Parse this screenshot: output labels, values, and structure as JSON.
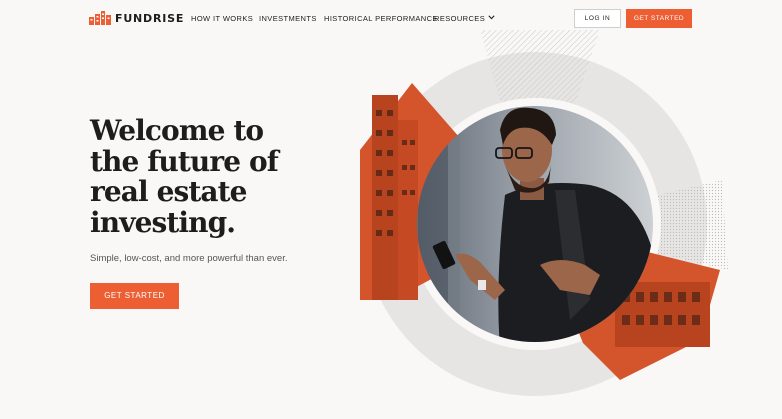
{
  "brand": {
    "name": "FUNDRISE",
    "accent": "#ee5e33"
  },
  "nav": {
    "items": [
      {
        "label": "HOW IT WORKS"
      },
      {
        "label": "INVESTMENTS"
      },
      {
        "label": "HISTORICAL PERFORMANCE"
      },
      {
        "label": "RESOURCES",
        "icon": "chevron-down-icon"
      }
    ],
    "login_label": "LOG IN",
    "cta_label": "GET STARTED"
  },
  "hero": {
    "headline_lines": [
      "Welcome to",
      "the future of",
      "real estate",
      "investing."
    ],
    "subtitle": "Simple, low-cost, and more powerful than ever.",
    "cta_label": "GET STARTED"
  }
}
